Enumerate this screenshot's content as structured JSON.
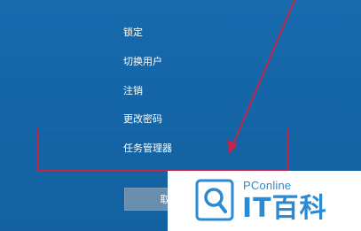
{
  "power_menu": {
    "items": [
      {
        "label": "锁定"
      },
      {
        "label": "切换用户"
      },
      {
        "label": "注销"
      },
      {
        "label": "更改密码"
      },
      {
        "label": "任务管理器"
      }
    ],
    "highlighted_item": "任务管理器",
    "cancel_label": "取"
  },
  "watermark": {
    "site": "PConline",
    "brand": "IT百科"
  },
  "colors": {
    "background": "#1566a8",
    "annotation": "#c6254a",
    "brand_blue": "#2a8ad2"
  },
  "icons": [
    "arrow-annotation-icon",
    "magnifier-logo-icon"
  ]
}
